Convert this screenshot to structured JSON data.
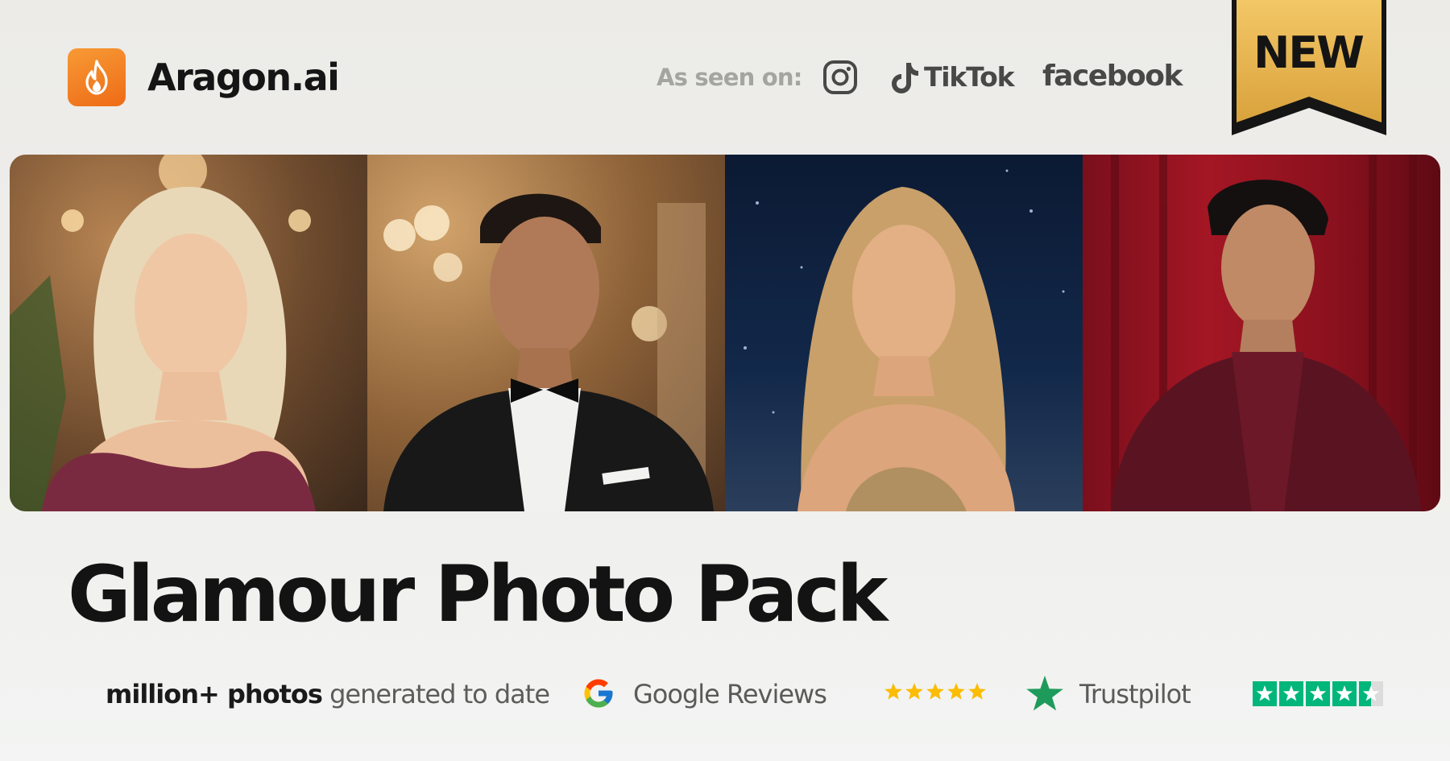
{
  "header": {
    "brand_name": "Aragon.ai",
    "seen_on_label": "As seen on:",
    "media": {
      "instagram_icon": "instagram-icon",
      "tiktok_label": "TikTok",
      "facebook_label": "facebook"
    },
    "badge_label": "NEW"
  },
  "gallery": {
    "photos": [
      {
        "subject": "blonde woman in burgundy satin dress",
        "background": "warm ballroom with wall sconces"
      },
      {
        "subject": "man in black tuxedo with bow tie",
        "background": "warm lit hallway"
      },
      {
        "subject": "woman with long blonde hair in gold slip dress",
        "background": "starry night sky"
      },
      {
        "subject": "man in burgundy velvet blazer",
        "background": "red velvet curtain"
      }
    ]
  },
  "title": "Glamour Photo Pack",
  "stats": {
    "photos_bold": "million+ photos",
    "photos_rest": " generated to date",
    "google_label": "Google Reviews",
    "google_stars": 5,
    "trustpilot_label": "Trustpilot",
    "trustpilot_rating": 4.5
  },
  "colors": {
    "brand_orange": "#f0731c",
    "badge_gold": "#e8b34a",
    "trustpilot_green": "#00b67a",
    "google_star_yellow": "#fbbc04"
  }
}
